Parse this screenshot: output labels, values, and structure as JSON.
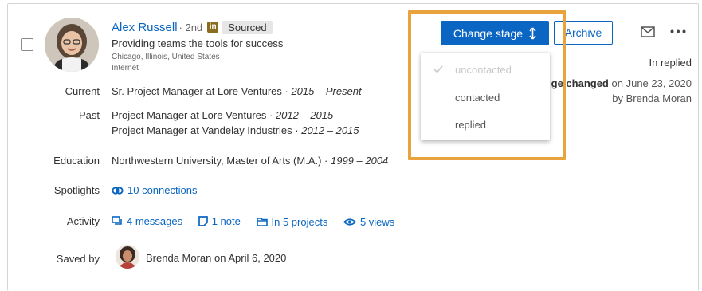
{
  "profile": {
    "name": "Alex Russell",
    "degree": "· 2nd",
    "linkedin_badge": "in",
    "source_tag": "Sourced",
    "headline": "Providing teams the tools for success",
    "location": "Chicago, Illinois, United States",
    "industry": "Internet"
  },
  "fields": {
    "current": {
      "label": "Current",
      "value": "Sr. Project Manager at Lore Ventures · ",
      "dates": "2015 – Present"
    },
    "past": {
      "label": "Past",
      "items": [
        {
          "value": "Project Manager at Lore Ventures · ",
          "dates": "2012 – 2015"
        },
        {
          "value": "Project Manager at Vandelay Industries · ",
          "dates": "2012 – 2015"
        }
      ]
    },
    "education": {
      "label": "Education",
      "value": "Northwestern University, Master of Arts (M.A.) · ",
      "dates": "1999 – 2004"
    },
    "spotlights": {
      "label": "Spotlights",
      "connections": "10 connections"
    },
    "activity": {
      "label": "Activity",
      "messages": "4 messages",
      "notes": "1 note",
      "projects": "In 5 projects",
      "views": "5 views"
    },
    "saved_by": {
      "label": "Saved by",
      "name": "Brenda Moran",
      "suffix": "on April 6, 2020"
    }
  },
  "actions": {
    "change_stage": "Change stage",
    "archive": "Archive",
    "icons": [
      "mail-icon",
      "more-icon",
      "sort-arrows-icon",
      "checkmark-icon"
    ]
  },
  "stage": {
    "current": "In replied",
    "changed_label": "ge changed",
    "changed_date": "on June 23, 2020",
    "changed_by": "by Brenda Moran"
  },
  "dropdown": {
    "options": [
      "uncontacted",
      "contacted",
      "replied"
    ]
  },
  "colors": {
    "accent": "#0a66c2",
    "highlight": "#e8a33d"
  }
}
